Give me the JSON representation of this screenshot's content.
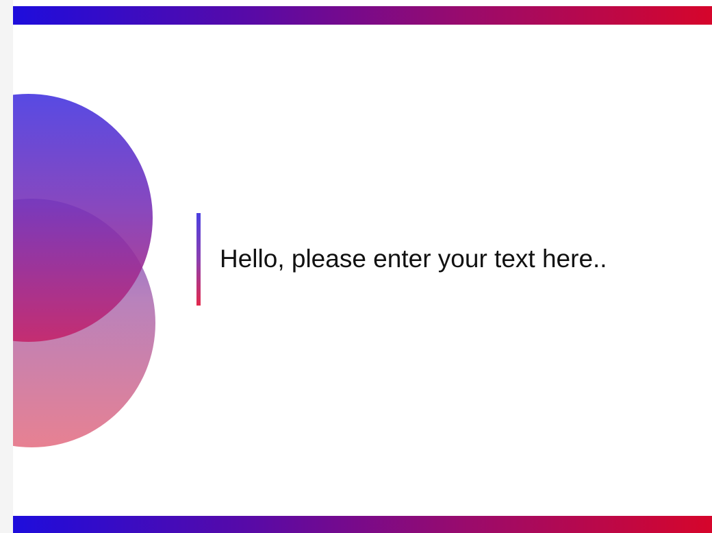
{
  "slide": {
    "text": "Hello, please enter your text here..",
    "colors": {
      "gradient_start": "#1e0ddc",
      "gradient_end": "#d6052b",
      "circle_top": "#4536e0",
      "circle_bottom": "#e67a8c",
      "text": "#111111",
      "background": "#ffffff"
    }
  }
}
